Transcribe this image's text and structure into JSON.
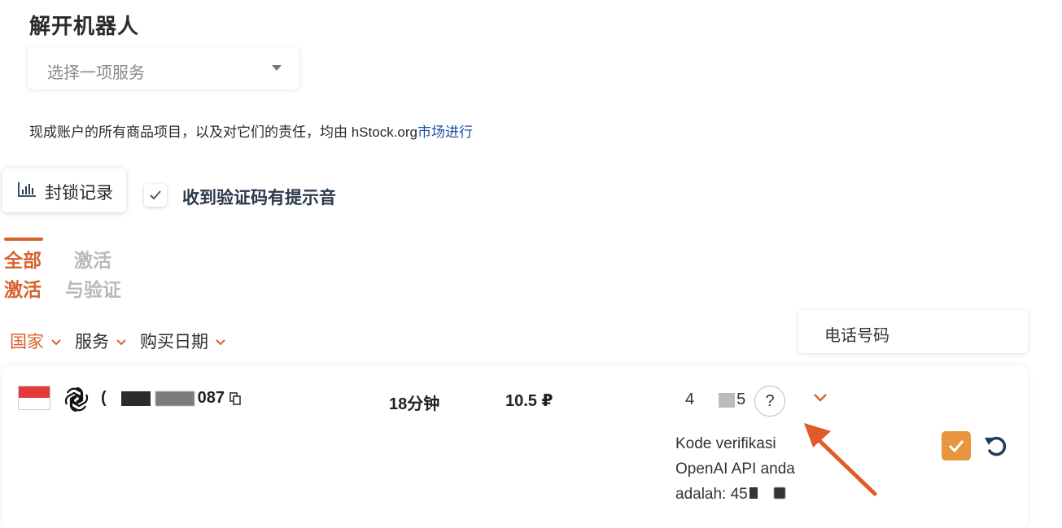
{
  "header": {
    "title": "解开机器人"
  },
  "service_select": {
    "placeholder": "选择一项服务"
  },
  "notice": {
    "text": "现成账户的所有商品项目，以及对它们的责任，均由 hStock.org",
    "link": "市场进行"
  },
  "block_log_button": {
    "label": "封锁记录",
    "icon": "bar-chart-icon"
  },
  "sound_checkbox": {
    "checked": true,
    "label": "收到验证码有提示音"
  },
  "tabs": [
    {
      "line1": "全部",
      "line2": "激活",
      "active": true
    },
    {
      "line1": "激活",
      "line2": "与验证",
      "active": false
    }
  ],
  "filters": [
    {
      "label": "国家",
      "active": true
    },
    {
      "label": "服务",
      "active": false
    },
    {
      "label": "购买日期",
      "active": false
    }
  ],
  "phone_search": {
    "placeholder": "电话号码"
  },
  "activation": {
    "flag_colors": [
      "#e23b3b",
      "#ffffff"
    ],
    "service_icon": "openai-icon",
    "number_prefix": "(",
    "number_suffix": "087",
    "time_left": "18分钟",
    "price": "10.5 ₽",
    "code_prefix": "4",
    "code_suffix": "5",
    "help": "?",
    "sms_line1": "Kode verifikasi",
    "sms_line2": "OpenAI API anda",
    "sms_line3": "adalah: 45"
  },
  "colors": {
    "accent": "#d8622d",
    "confirm": "#e8963e",
    "link": "#1e4f9c"
  }
}
